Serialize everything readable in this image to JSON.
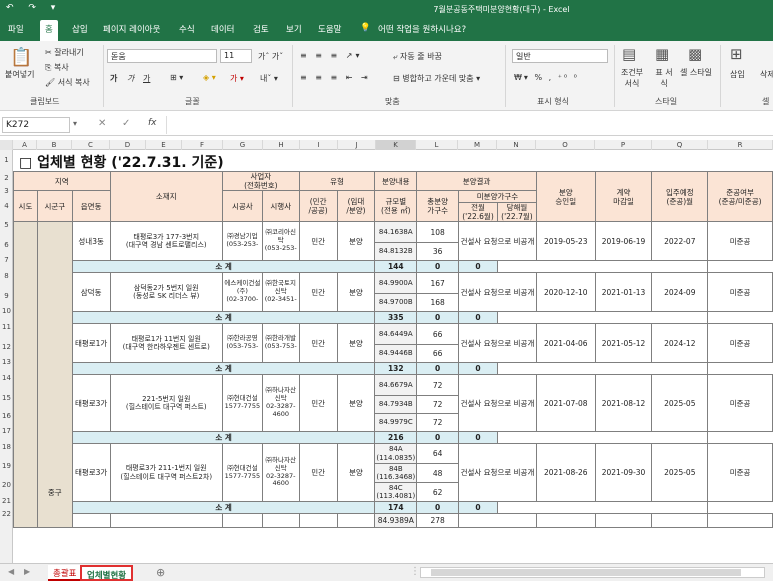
{
  "window": {
    "title": "7월분공동주택미분양현황(대구) - Excel",
    "qat": "↶ ↷ ▾"
  },
  "tabs": [
    "파일",
    "홈",
    "삽입",
    "페이지 레이아웃",
    "수식",
    "데이터",
    "검토",
    "보기",
    "도움말"
  ],
  "tell_me": "어떤 작업을 원하시나요?",
  "ribbon": {
    "clipboard": {
      "paste": "붙여넣기",
      "cut": "잘라내기",
      "copy": "복사",
      "format": "서식 복사",
      "group": "클립보드"
    },
    "font": {
      "name": "돋움",
      "size": "11",
      "bold": "가",
      "italic": "가",
      "underline": "가",
      "group": "글꼴"
    },
    "align": {
      "wrap": "자동 줄 바꿈",
      "merge": "병합하고 가운데 맞춤",
      "group": "맞춤"
    },
    "number": {
      "format": "일반",
      "group": "표시 형식"
    },
    "styles": {
      "cond": "조건부 서식",
      "table": "표 서식",
      "cell": "셀 스타일",
      "group": "스타일"
    },
    "cells": {
      "insert": "삽입",
      "delete": "삭제",
      "group": "셀"
    }
  },
  "formula": {
    "namebox": "K272",
    "fx": "fx",
    "cancel": "✕",
    "enter": "✓"
  },
  "columns": [
    "A",
    "B",
    "C",
    "D",
    "E",
    "F",
    "G",
    "H",
    "I",
    "J",
    "K",
    "L",
    "M",
    "N",
    "O",
    "P",
    "Q",
    "R"
  ],
  "rows": [
    "1",
    "2",
    "3",
    "4",
    "5",
    "6",
    "7",
    "8",
    "9",
    "10",
    "11",
    "12",
    "13",
    "14",
    "15",
    "16",
    "17",
    "18",
    "19",
    "20",
    "21",
    "22"
  ],
  "sheet": {
    "title": "□ 업체별 현황 ('22.7.31. 기준)",
    "headers": {
      "region": "지역",
      "sido": "시도",
      "sigungu": "시군구",
      "eupmyeon": "읍면동",
      "address": "소재지",
      "company": "사업자\n(전화번호)",
      "builder": "시공사",
      "developer": "시행사",
      "type": "유형",
      "private": "(민간\n/공공)",
      "rental": "(임대\n/분양)",
      "content": "분양내용",
      "size": "규모별\n(전용 ㎡)",
      "result": "분양결과",
      "total": "총분양\n가구수",
      "unsold": "미분양가구수",
      "prev": "전월\n('22.6월)",
      "curr": "당해월\n('22.7월)",
      "approval": "분양\n승인일",
      "contract": "계약\n마감일",
      "movein": "입주예정\n(준공)월",
      "done": "준공여부\n(준공/미준공)"
    },
    "district": "중구",
    "subtotal_label": "소  계",
    "projects": [
      {
        "dong": "성내3동",
        "addr": "태평로3가 177-3번지\n(대구역 경남 센트로팰리스)",
        "builder": "㈜경남기업\n(053-253-",
        "dev": "㈜코리아신탁\n(053-253-",
        "pp": "민간",
        "rs": "분양",
        "sizes": [
          "84.1638A",
          "84.8132B"
        ],
        "totals": [
          "108",
          "36"
        ],
        "status": "건설사 요청으로 비공개",
        "appr": "2019-05-23",
        "cont": "2019-06-19",
        "move": "2022-07",
        "done": "미준공",
        "sum": "144",
        "sp": "0",
        "sc": "0"
      },
      {
        "dong": "삼덕동",
        "addr": "삼덕동2가 5번지 일원\n(동성로 SK 리더스 뷰)",
        "builder": "에스케이건설(주)\n(02-3700-",
        "dev": "㈜한국토지신탁\n(02-3451-",
        "pp": "민간",
        "rs": "분양",
        "sizes": [
          "84.9900A",
          "84.9700B"
        ],
        "totals": [
          "167",
          "168"
        ],
        "status": "건설사 요청으로 비공개",
        "appr": "2020-12-10",
        "cont": "2021-01-13",
        "move": "2024-09",
        "done": "미준공",
        "sum": "335",
        "sp": "0",
        "sc": "0"
      },
      {
        "dong": "태평로1가",
        "addr": "태평로1가 11번지 일원\n(대구역 한라하우젠트 센트로)",
        "builder": "㈜한라공영\n(053-753-",
        "dev": "㈜한라개발\n(053-753-",
        "pp": "민간",
        "rs": "분양",
        "sizes": [
          "84.6449A",
          "84.9446B"
        ],
        "totals": [
          "66",
          "66"
        ],
        "status": "건설사 요청으로 비공개",
        "appr": "2021-04-06",
        "cont": "2021-05-12",
        "move": "2024-12",
        "done": "미준공",
        "sum": "132",
        "sp": "0",
        "sc": "0"
      },
      {
        "dong": "태평로3가",
        "addr": "221-5번지 일원\n(힐스테이트 대구역 퍼스트)",
        "builder": "㈜현대건설\n1577-7755",
        "dev": "㈜하나자산신탁\n02-3287-4600",
        "pp": "민간",
        "rs": "분양",
        "sizes": [
          "84.6679A",
          "84.7934B",
          "84.9979C"
        ],
        "totals": [
          "72",
          "72",
          "72"
        ],
        "status": "건설사 요청으로 비공개",
        "appr": "2021-07-08",
        "cont": "2021-08-12",
        "move": "2025-05",
        "done": "미준공",
        "sum": "216",
        "sp": "0",
        "sc": "0"
      },
      {
        "dong": "태평로3가",
        "addr": "태평로3가 211-1번지 일원\n(힐스테이트 대구역 퍼스트2차)",
        "builder": "㈜현대건설\n1577-7755",
        "dev": "㈜하나자산신탁\n02-3287-4600",
        "pp": "민간",
        "rs": "분양",
        "sizes": [
          "84A\n(114.0835)",
          "84B\n(116.3468)",
          "84C\n(113.4081)"
        ],
        "totals": [
          "64",
          "48",
          "62"
        ],
        "status": "건설사 요청으로 비공개",
        "appr": "2021-08-26",
        "cont": "2021-09-30",
        "move": "2025-05",
        "done": "미준공",
        "sum": "174",
        "sp": "0",
        "sc": "0"
      }
    ],
    "last_row": {
      "size": "84.9389A",
      "total": "278"
    }
  },
  "sheet_tabs": [
    {
      "label": "총괄표",
      "color": "#c00000"
    },
    {
      "label": "업체별현황",
      "active": true
    }
  ],
  "add_sheet": "⊕"
}
